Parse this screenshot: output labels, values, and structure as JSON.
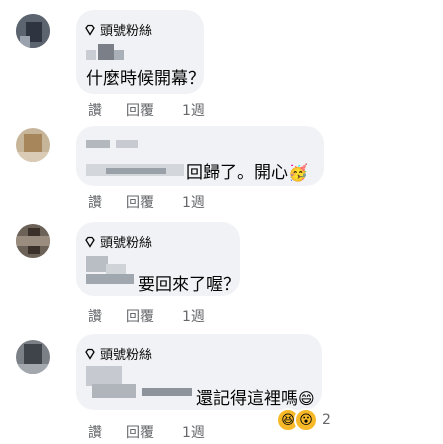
{
  "comments": [
    {
      "badge": "頭號粉絲",
      "text": "什麼時候開幕？",
      "actions": {
        "like": "讚",
        "reply": "回覆",
        "time": "1週"
      }
    },
    {
      "badge": "",
      "text": "回歸了。開心",
      "emoji": "🥳",
      "actions": {
        "like": "讚",
        "reply": "回覆",
        "time": "1週"
      }
    },
    {
      "badge": "頭號粉絲",
      "text": "要回來了喔？",
      "actions": {
        "like": "讚",
        "reply": "回覆",
        "time": "1週"
      }
    },
    {
      "badge": "頭號粉絲",
      "text": "還記得這裡嗎",
      "emoji": "😄",
      "actions": {
        "like": "讚",
        "reply": "回覆",
        "time": "1週"
      },
      "reactions": {
        "icons": [
          "😆",
          "😮"
        ],
        "count": "2"
      }
    }
  ],
  "colors": {
    "bubble": "#f0f2f5",
    "secondary_text": "#65676b",
    "text": "#050505"
  }
}
